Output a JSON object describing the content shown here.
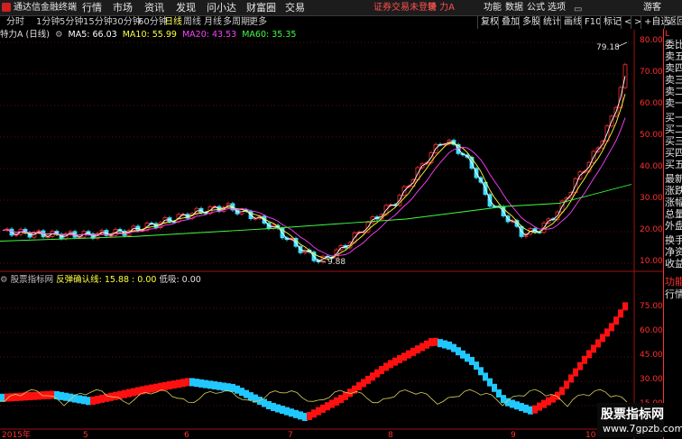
{
  "menu": {
    "app_title": "通达信金融终端",
    "items": [
      "行情",
      "市场",
      "资讯",
      "发现",
      "问小达",
      "财富圈",
      "交易"
    ],
    "login_status": "证券交易未登录",
    "stock_title": "特 力A",
    "right_items": [
      "功能",
      "数据",
      "公式",
      "选项"
    ],
    "guest": "游客"
  },
  "periods": {
    "items": [
      "分时",
      "1分钟",
      "5分钟",
      "15分钟",
      "30分钟",
      "60分钟",
      "日线",
      "周线",
      "月线",
      "多周期",
      "更多"
    ],
    "active": "日线"
  },
  "right_toolbar": [
    "复权",
    "叠加",
    "多股",
    "统计",
    "画线",
    "F10",
    "标记",
    "<",
    ">",
    "+自选",
    "返回"
  ],
  "stock_label": "特力A (日线)",
  "ma_legend": [
    {
      "text": "MA5: 66.03",
      "color": "#ffffff"
    },
    {
      "text": "MA10: 55.99",
      "color": "#ffff40"
    },
    {
      "text": "MA20: 43.53",
      "color": "#ff40ff"
    },
    {
      "text": "MA60: 35.35",
      "color": "#40ff40"
    }
  ],
  "indicator_legend": [
    {
      "text": "股票指标网",
      "color": "#c0c0c0"
    },
    {
      "text": "反弹确认线: 15.88 : 0.00",
      "color": "#ffff40"
    },
    {
      "text": "低吸: 0.00",
      "color": "#e0e0e0"
    }
  ],
  "right_panel": [
    "L",
    "委比",
    "卖五",
    "卖四",
    "卖三",
    "卖二",
    "卖一",
    "买一",
    "买二",
    "买三",
    "买四",
    "买五",
    "最新",
    "涨跌",
    "涨幅",
    "总量",
    "外盘",
    "换手",
    "净资",
    "收益",
    "功能",
    "行情"
  ],
  "price_axis": [
    "80.00",
    "70.00",
    "60.00",
    "50.00",
    "40.00",
    "30.00",
    "20.00",
    "10.00"
  ],
  "indicator_axis": [
    "75.00",
    "60.00",
    "45.00",
    "30.00",
    "15.00"
  ],
  "annotations": {
    "high": "79.18",
    "low": "9.88"
  },
  "date_labels": [
    "2015年",
    "5",
    "6",
    "7",
    "8",
    "9",
    "10"
  ],
  "watermark": {
    "line1": "股票指标网",
    "line2": "www.7gpzb.com"
  },
  "colors": {
    "up": "#ff3030",
    "down": "#40e0ff",
    "ma5": "#ffffff",
    "ma10": "#ffff40",
    "ma20": "#ff40ff",
    "ma60": "#40ff40"
  }
}
